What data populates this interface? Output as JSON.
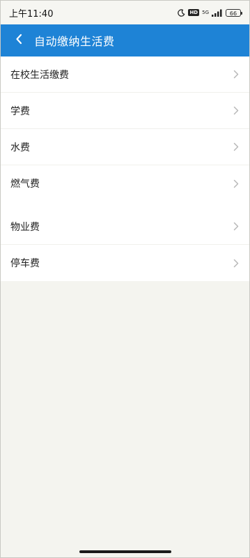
{
  "status_bar": {
    "time": "上午11:40",
    "network": "5G",
    "battery": "66"
  },
  "header": {
    "title": "自动缴纳生活费"
  },
  "groups": [
    {
      "items": [
        {
          "label": "在校生活缴费"
        },
        {
          "label": "学费"
        },
        {
          "label": "水费"
        },
        {
          "label": "燃气费"
        }
      ]
    },
    {
      "items": [
        {
          "label": "物业费"
        },
        {
          "label": "停车费"
        }
      ]
    }
  ],
  "colors": {
    "header_bg": "#1e83d6",
    "page_bg": "#f4f4ef"
  },
  "icons": {
    "back": "chevron-left-icon",
    "row_arrow": "chevron-right-icon"
  }
}
